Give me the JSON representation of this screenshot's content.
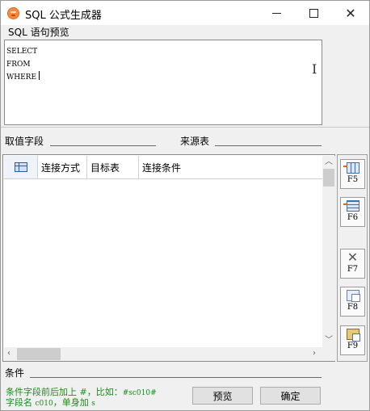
{
  "window": {
    "title": "SQL 公式生成器",
    "controls": {
      "minimize": "–",
      "maximize": "□",
      "close": "✕"
    }
  },
  "sql_preview": {
    "label": "SQL 语句预览",
    "lines": [
      "SELECT",
      "FROM",
      "WHERE"
    ]
  },
  "fields": {
    "value_field_label": "取值字段",
    "value_field_value": "",
    "source_table_label": "来源表",
    "source_table_value": ""
  },
  "grid": {
    "columns": [
      "连接方式",
      "目标表",
      "连接条件"
    ],
    "rows": []
  },
  "side_buttons": [
    {
      "key": "F5",
      "icon": "insert-row-icon"
    },
    {
      "key": "F6",
      "icon": "add-row-icon"
    },
    {
      "key": "F7",
      "icon": "delete-icon"
    },
    {
      "key": "F8",
      "icon": "copy-icon"
    },
    {
      "key": "F9",
      "icon": "paste-icon"
    }
  ],
  "condition": {
    "label": "条件",
    "value": ""
  },
  "hint": {
    "line1_prefix": "条件字段前后加上 #，比如：",
    "line1_code": "#sc010#",
    "line2_prefix": "字段名 ",
    "line2_code": "c010",
    "line2_mid": "，单身加 ",
    "line2_code2": "s"
  },
  "buttons": {
    "preview": "预览",
    "ok": "确定"
  }
}
